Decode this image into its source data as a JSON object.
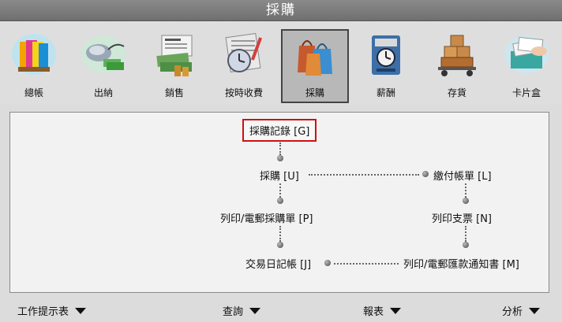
{
  "title": "採購",
  "modules": [
    {
      "label": "總帳",
      "icon": "ledger-folders-icon"
    },
    {
      "label": "出納",
      "icon": "cashier-mouse-icon"
    },
    {
      "label": "銷售",
      "icon": "sales-invoice-money-icon"
    },
    {
      "label": "按時收費",
      "icon": "timesheet-clock-icon"
    },
    {
      "label": "採購",
      "icon": "shopping-bags-icon",
      "selected": true
    },
    {
      "label": "薪酬",
      "icon": "payroll-time-clock-icon"
    },
    {
      "label": "存貨",
      "icon": "inventory-boxes-icon"
    },
    {
      "label": "卡片盒",
      "icon": "cardfile-icon"
    }
  ],
  "flow": {
    "records": "採購記錄 [G]",
    "purchase": "採購 [U]",
    "pay_bills": "繳付帳單 [L]",
    "print_purchase": "列印/電郵採購單 [P]",
    "print_cheques": "列印支票 [N]",
    "journal": "交易日記帳 [J]",
    "remittance": "列印/電郵匯款通知書 [M]"
  },
  "bottom": {
    "todo": "工作提示表",
    "find": "查詢",
    "reports": "報表",
    "analysis": "分析"
  },
  "colors": {
    "highlight_border": "#d01010",
    "titlebar": "#7a7a7a"
  }
}
